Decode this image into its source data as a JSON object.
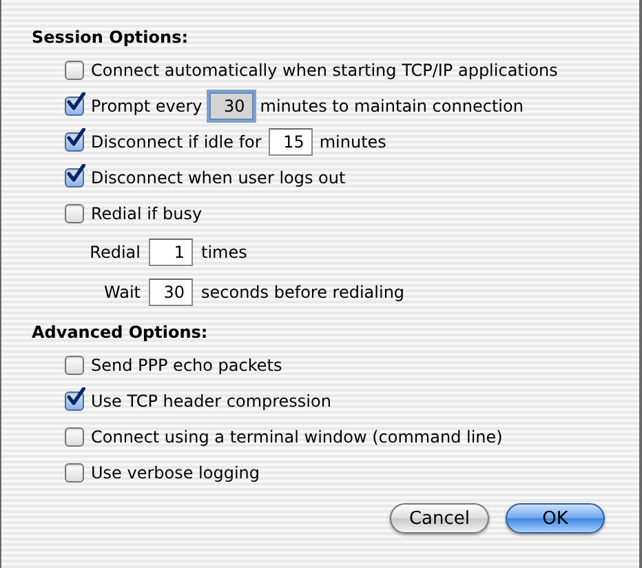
{
  "sections": [
    {
      "title": "Session Options:",
      "rows": [
        {
          "kind": "checkbox",
          "checked": false,
          "label": "Connect automatically when starting TCP/IP applications"
        },
        {
          "kind": "checkbox-field",
          "checked": true,
          "before": "Prompt every",
          "value": "30",
          "after": "minutes to maintain connection",
          "focused": true
        },
        {
          "kind": "checkbox-field",
          "checked": true,
          "before": "Disconnect if idle for",
          "value": "15",
          "after": "minutes",
          "focused": false
        },
        {
          "kind": "checkbox",
          "checked": true,
          "label": "Disconnect when user logs out"
        },
        {
          "kind": "checkbox",
          "checked": false,
          "label": "Redial if busy"
        },
        {
          "kind": "field",
          "before": "Redial",
          "value": "1",
          "after": "times",
          "focused": false
        },
        {
          "kind": "field",
          "before": "Wait",
          "value": "30",
          "after": "seconds before redialing",
          "focused": false
        }
      ]
    },
    {
      "title": "Advanced Options:",
      "rows": [
        {
          "kind": "checkbox",
          "checked": false,
          "label": "Send PPP echo packets"
        },
        {
          "kind": "checkbox",
          "checked": true,
          "label": "Use TCP header compression"
        },
        {
          "kind": "checkbox",
          "checked": false,
          "label": "Connect using a terminal window (command line)"
        },
        {
          "kind": "checkbox",
          "checked": false,
          "label": "Use verbose logging"
        }
      ]
    }
  ],
  "buttons": [
    {
      "label": "Cancel",
      "default": false
    },
    {
      "label": "OK",
      "default": true
    }
  ]
}
